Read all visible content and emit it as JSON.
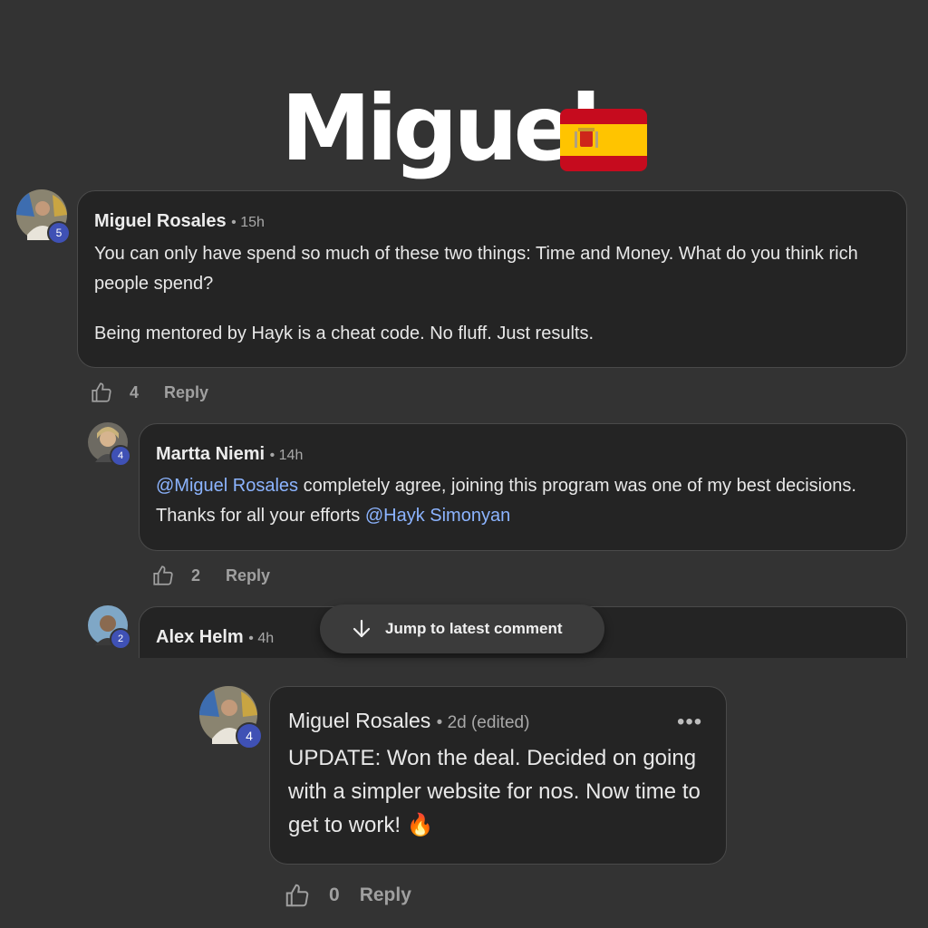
{
  "header": {
    "title": "Miguel",
    "flag_icon": "spain-flag-icon",
    "flag_colors": {
      "red": "#c60b1e",
      "yellow": "#ffc400"
    }
  },
  "comments": [
    {
      "author": "Miguel Rosales",
      "time": "• 15h",
      "badge": "5",
      "paragraphs": [
        "You can only have spend so much of these two things: Time and Money. What do you think rich people spend?",
        "Being mentored by Hayk is a cheat code. No fluff. Just results."
      ],
      "likes": "4",
      "reply_label": "Reply"
    },
    {
      "author": "Martta Niemi",
      "time": "• 14h",
      "badge": "4",
      "mention1": "@Miguel Rosales",
      "text1": " completely agree, joining this program was one of my best decisions. Thanks for all your efforts ",
      "mention2": "@Hayk Simonyan",
      "likes": "2",
      "reply_label": "Reply"
    },
    {
      "author": "Alex Helm",
      "time": "• 4h",
      "badge": "2"
    },
    {
      "author": "Miguel Rosales",
      "time": "• 2d (edited)",
      "badge": "4",
      "text": "UPDATE: Won the deal. Decided on going with a simpler website for nos. Now time to get to work! 🔥",
      "likes": "0",
      "reply_label": "Reply",
      "menu_icon": "more-options-icon"
    }
  ],
  "jump_button": {
    "label": "Jump to latest comment",
    "icon": "arrow-down-icon"
  },
  "colors": {
    "background": "#333333",
    "card": "#242424",
    "mention": "#8cb4ff",
    "badge": "#3f51b5"
  }
}
